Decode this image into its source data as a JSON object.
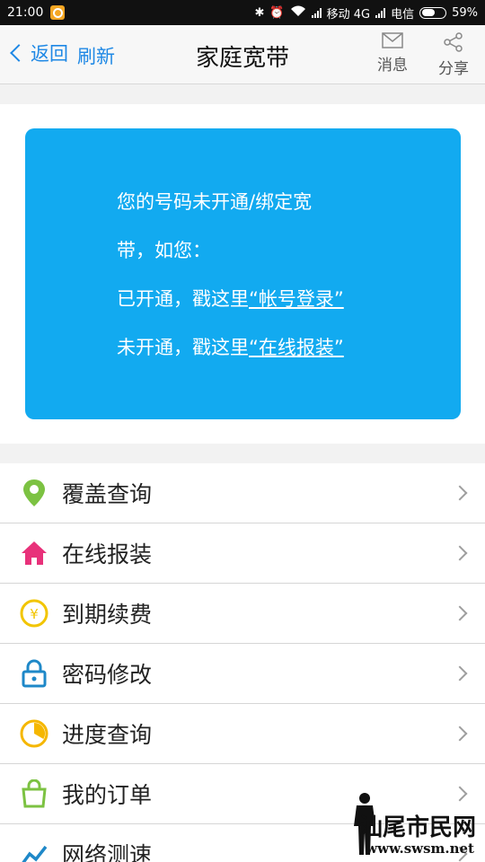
{
  "status_bar": {
    "time": "21:00",
    "carrier1": "移动 4G",
    "carrier2": "电信",
    "battery": "59%",
    "battery_level": 0.59
  },
  "nav": {
    "back_label": "返回",
    "refresh_label": "刷新",
    "title": "家庭宽带",
    "message_label": "消息",
    "share_label": "分享"
  },
  "banner": {
    "line1": "您的号码未开通/绑定宽",
    "line2": "带，如您：",
    "line3_prefix": "已开通，戳这里",
    "line3_link": "“帐号登录”",
    "line4_prefix": "未开通，戳这里",
    "line4_link": "“在线报装”"
  },
  "menu": {
    "items": [
      {
        "label": "覆盖查询",
        "icon": "location-pin-icon",
        "color": "#7cc242"
      },
      {
        "label": "在线报装",
        "icon": "home-icon",
        "color": "#e8317a"
      },
      {
        "label": "到期续费",
        "icon": "yen-coin-icon",
        "color": "#f2c500"
      },
      {
        "label": "密码修改",
        "icon": "lock-icon",
        "color": "#1e88c8"
      },
      {
        "label": "进度查询",
        "icon": "progress-pie-icon",
        "color": "#f5b700"
      },
      {
        "label": "我的订单",
        "icon": "shopping-bag-icon",
        "color": "#7cc242"
      },
      {
        "label": "网络测速",
        "icon": "speed-chart-icon",
        "color": "#1e88c8"
      }
    ]
  },
  "watermark": {
    "text": "汕尾市民网",
    "url": "www.swsm.net"
  }
}
